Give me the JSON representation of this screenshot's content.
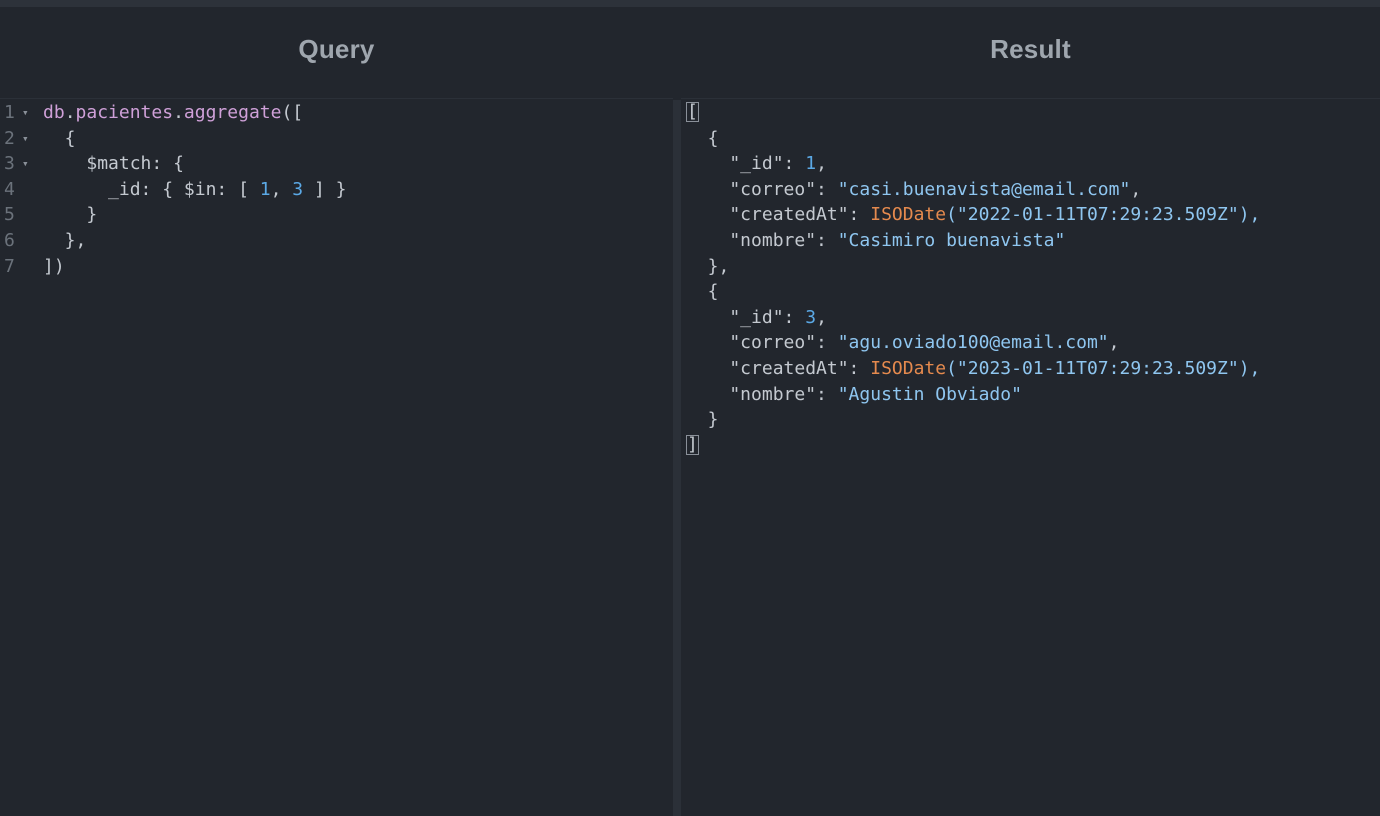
{
  "headers": {
    "query": "Query",
    "result": "Result"
  },
  "query": {
    "line_numbers": [
      "1",
      "2",
      "3",
      "4",
      "5",
      "6",
      "7"
    ],
    "folds": [
      true,
      true,
      true,
      false,
      false,
      false,
      false
    ],
    "l1_obj": "db",
    "l1_dot1": ".",
    "l1_coll": "pacientes",
    "l1_dot2": ".",
    "l1_method": "aggregate",
    "l1_open": "([",
    "l2": "  {",
    "l3_indent": "    ",
    "l3_op": "$match",
    "l3_rest": ": {",
    "l4_indent": "      ",
    "l4_key": "_id",
    "l4_mid": ": { $in: [ ",
    "l4_n1": "1",
    "l4_comma": ", ",
    "l4_n2": "3",
    "l4_end": " ] }",
    "l5": "    }",
    "l6": "  },",
    "l7": "])"
  },
  "result": {
    "open": "[",
    "close": "]",
    "docs": [
      {
        "open": "  {",
        "id_key": "    \"_id\": ",
        "id_val": "1",
        "correo_key": "    \"correo\": ",
        "correo_val": "\"casi.buenavista@email.com\"",
        "created_key": "    \"createdAt\": ",
        "created_fn": "ISODate",
        "created_val": "(\"2022-01-11T07:29:23.509Z\"),",
        "nombre_key": "    \"nombre\": ",
        "nombre_val": "\"Casimiro buenavista\"",
        "close": "  },"
      },
      {
        "open": "  {",
        "id_key": "    \"_id\": ",
        "id_val": "3",
        "correo_key": "    \"correo\": ",
        "correo_val": "\"agu.oviado100@email.com\"",
        "created_key": "    \"createdAt\": ",
        "created_fn": "ISODate",
        "created_val": "(\"2023-01-11T07:29:23.509Z\"),",
        "nombre_key": "    \"nombre\": ",
        "nombre_val": "\"Agustin Obviado\"",
        "close": "  }"
      }
    ]
  }
}
